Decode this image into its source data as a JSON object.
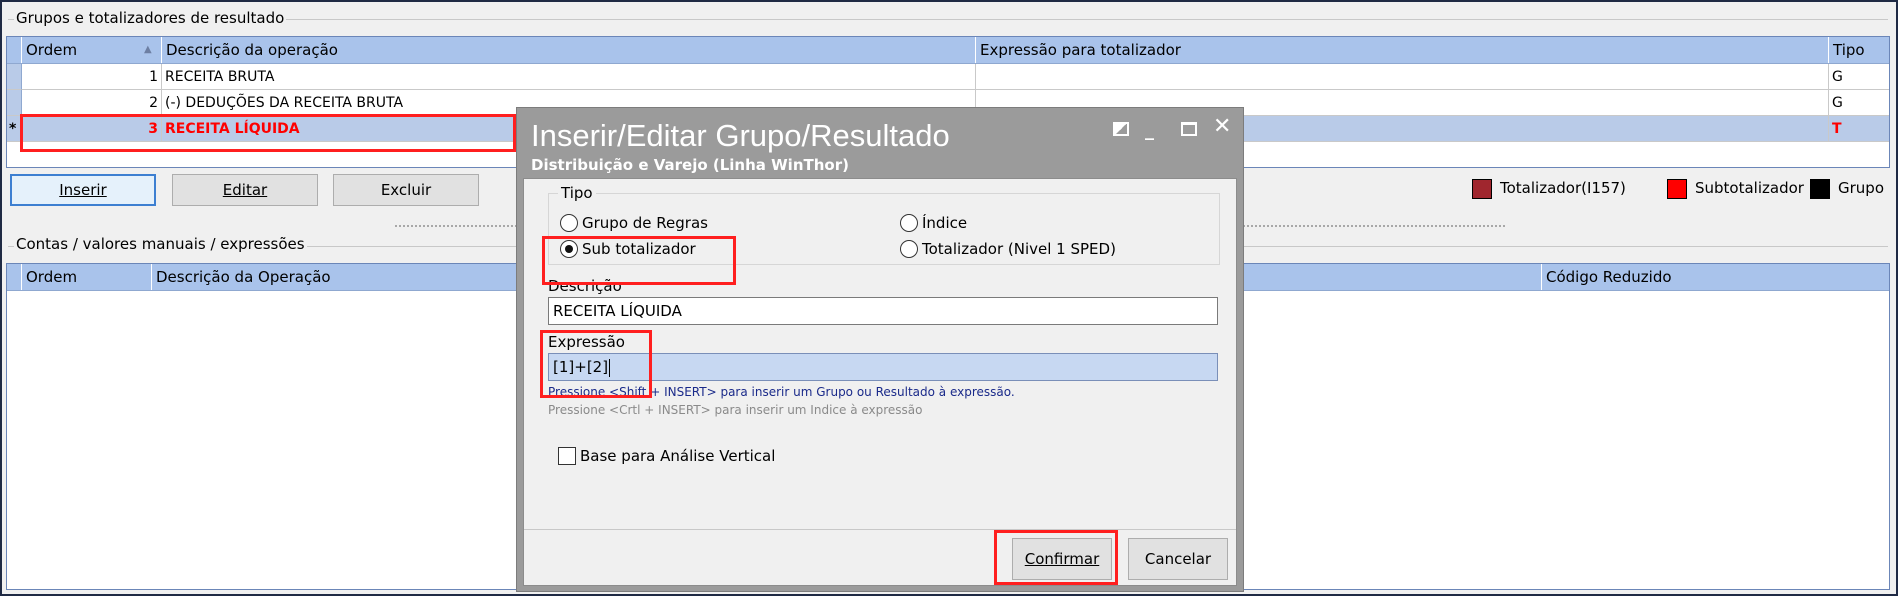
{
  "groups_section": {
    "title": "Grupos e totalizadores de resultado",
    "columns": [
      "Ordem",
      "Descrição da operação",
      "Expressão para totalizador",
      "Tipo"
    ],
    "sort_indicator": "▲",
    "rows": [
      {
        "marker": "",
        "ordem": "1",
        "descricao": "RECEITA BRUTA",
        "expressao": "",
        "tipo": "G"
      },
      {
        "marker": "",
        "ordem": "2",
        "descricao": "(-) DEDUÇÕES DA RECEITA BRUTA",
        "expressao": "",
        "tipo": "G"
      },
      {
        "marker": "*",
        "ordem": "3",
        "descricao": "RECEITA LÍQUIDA",
        "expressao": "",
        "tipo": "T"
      }
    ]
  },
  "buttons": {
    "inserir": "Inserir",
    "editar": "Editar",
    "excluir": "Excluir"
  },
  "legend": {
    "totalizador": "Totalizador(I157)",
    "subtotalizador": "Subtotalizador",
    "grupo": "Grupo",
    "colors": {
      "totalizador": "#a0262e",
      "subtotalizador": "#ff0000",
      "grupo": "#000000"
    }
  },
  "contas_section": {
    "title": "Contas / valores manuais / expressões",
    "columns": [
      "Ordem",
      "Descrição da Operação",
      "Código Reduzido"
    ]
  },
  "dialog": {
    "title": "Inserir/Editar Grupo/Resultado",
    "subtitle": "Distribuição e Varejo (Linha WinThor)",
    "tipo_label": "Tipo",
    "options": {
      "grupo_regras": "Grupo de Regras",
      "sub_totalizador": "Sub totalizador",
      "indice": "Índice",
      "totalizador": "Totalizador (Nivel 1 SPED)"
    },
    "selected_option": "sub_totalizador",
    "descricao_label": "Descrição",
    "descricao_value": "RECEITA LÍQUIDA",
    "expressao_label": "Expressão",
    "expressao_value": "[1]+[2]",
    "hint_1": "Pressione <Shift + INSERT> para inserir um Grupo ou Resultado à expressão.",
    "hint_2": "Pressione <Crtl + INSERT> para inserir um Indice à expressão",
    "checkbox_label": "Base para Análise Vertical",
    "confirmar": "Confirmar",
    "cancelar": "Cancelar"
  },
  "colors": {
    "header_bg": "#a9c3eb",
    "selected_row": "#b9cbe8",
    "highlight_red": "#ff1f1f",
    "dialog_title_bg": "#9b9b9b"
  }
}
